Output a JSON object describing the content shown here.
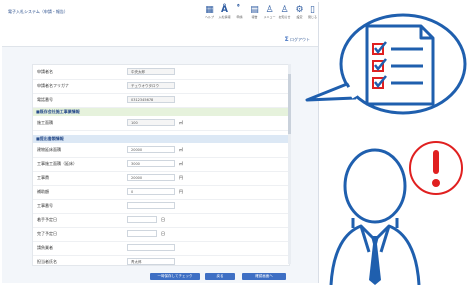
{
  "app_title": "電子入札システム（申請・報告）",
  "toolbar": [
    {
      "label": "ヘルプ",
      "icon": "document-icon"
    },
    {
      "label": "入札情報",
      "icon": "people-icon"
    },
    {
      "label": "申請",
      "icon": "people-icon"
    },
    {
      "label": "報告",
      "icon": "document-icon"
    },
    {
      "label": "メニュー",
      "icon": "person-icon"
    },
    {
      "label": "お知らせ",
      "icon": "person-icon"
    },
    {
      "label": "設定",
      "icon": "gear-icon"
    },
    {
      "label": "閉じる",
      "icon": "document-icon"
    }
  ],
  "logout": "ログアウト",
  "form": {
    "rows_top": [
      {
        "label": "申請者名",
        "value": "中央太郎",
        "unit": ""
      },
      {
        "label": "申請者名フリガナ",
        "value": "チュウオウタロウ",
        "unit": ""
      },
      {
        "label": "電話番号",
        "value": "0312345678",
        "unit": ""
      }
    ],
    "section1": "■既存会社施工事業情報",
    "rows_mid": [
      {
        "label": "施工面積",
        "value": "100",
        "unit": "㎡"
      }
    ],
    "section2": "■提出書類情報",
    "rows_bottom": [
      {
        "label": "建物延床面積",
        "value": "20000",
        "unit": "㎡"
      },
      {
        "label": "工事施工面積（延床）",
        "value": "3000",
        "unit": "㎡"
      },
      {
        "label": "工事費",
        "value": "20000",
        "unit": "円"
      },
      {
        "label": "補助額",
        "value": "0",
        "unit": "円"
      },
      {
        "label": "工事番号",
        "value": "",
        "unit": ""
      },
      {
        "label": "着手予定日",
        "value": "",
        "unit": "日"
      },
      {
        "label": "完了予定日",
        "value": "",
        "unit": "日"
      },
      {
        "label": "請負業者",
        "value": "",
        "unit": ""
      },
      {
        "label": "担当者氏名",
        "value": "青太郎",
        "unit": ""
      }
    ]
  },
  "buttons": {
    "temp_save": "一時保存してチェック",
    "back": "戻る",
    "next": "確認画面へ"
  },
  "colors": {
    "accent": "#3e6fc4",
    "alert": "#e02020",
    "tie": "#1f5fae"
  }
}
